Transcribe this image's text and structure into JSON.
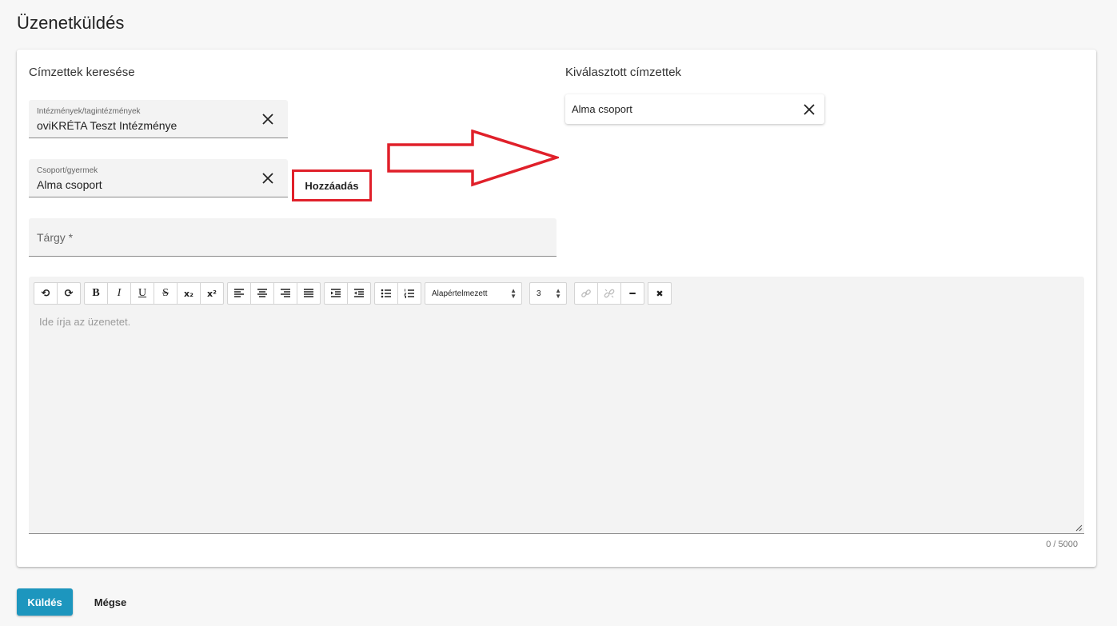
{
  "page": {
    "title": "Üzenetküldés"
  },
  "search": {
    "title": "Címzettek keresése",
    "institution": {
      "label": "Intézmények/tagintézmények",
      "value": "oviKRÉTA Teszt Intézménye"
    },
    "group": {
      "label": "Csoport/gyermek",
      "value": "Alma csoport"
    },
    "add_label": "Hozzáadás",
    "subject_placeholder": "Tárgy *"
  },
  "selected": {
    "title": "Kiválasztott címzettek",
    "items": [
      {
        "label": "Alma csoport"
      }
    ]
  },
  "editor": {
    "placeholder": "Ide írja az üzenetet.",
    "font_select": "Alapértelmezett",
    "size_select": "3",
    "counter": "0 / 5000",
    "toolbar": {
      "undo": "⟲",
      "redo": "⟳",
      "bold": "B",
      "italic": "I",
      "underline": "U",
      "strike": "S",
      "subscript": "x₂",
      "superscript": "x²",
      "horizontal_rule": "━",
      "clear": "✖"
    }
  },
  "actions": {
    "send": "Küldés",
    "cancel": "Mégse"
  },
  "colors": {
    "accent": "#1d96be",
    "annotation": "#e0202a"
  }
}
